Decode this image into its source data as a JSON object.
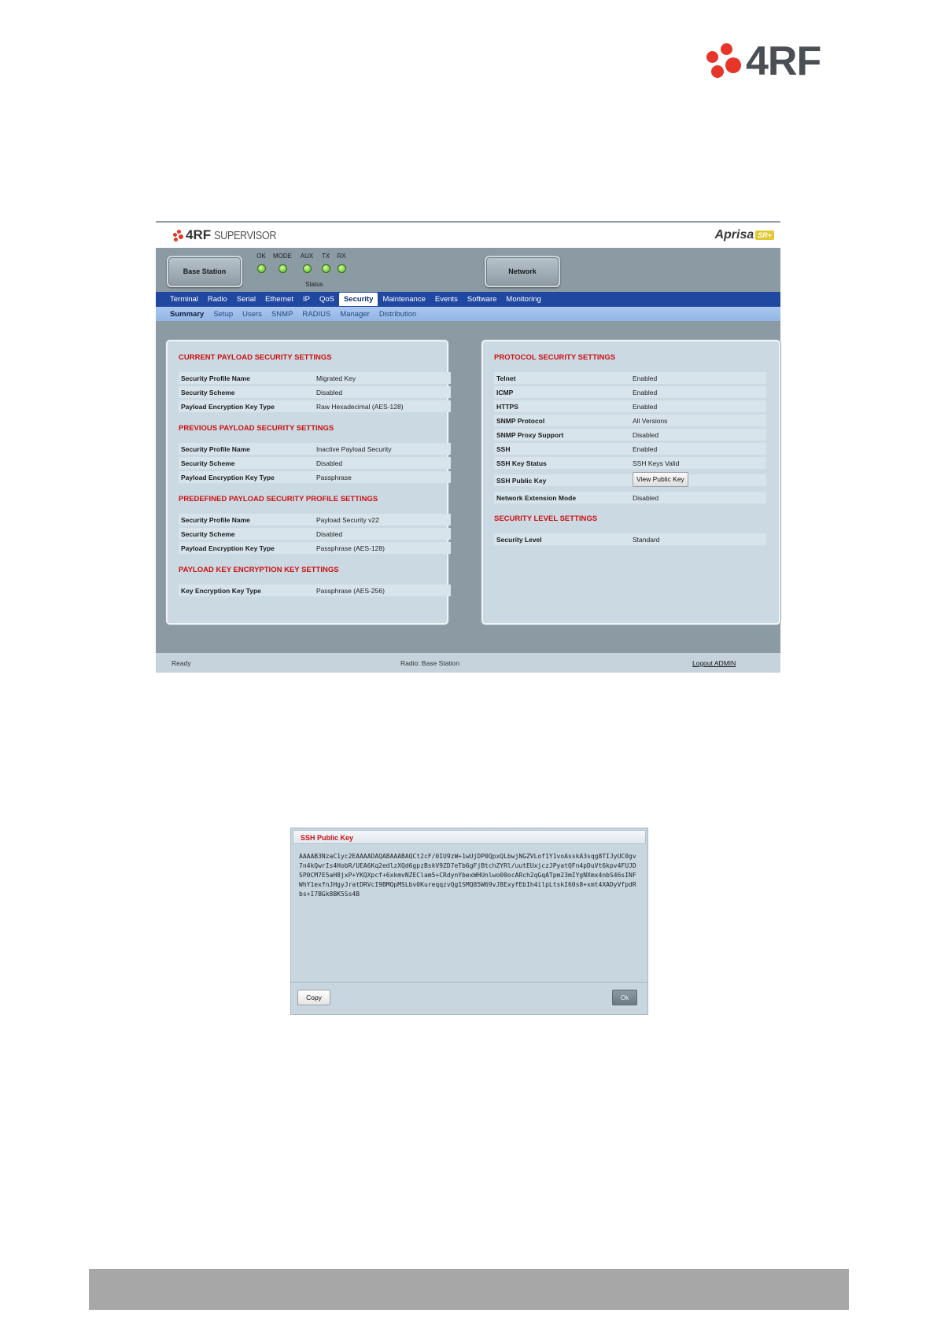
{
  "page": {
    "logo_text": "4RF"
  },
  "app": {
    "logo_brand": "4RF",
    "logo_product": "SUPERVISOR",
    "product_name": "Aprisa",
    "product_badge": "SR+",
    "header": {
      "base_station_label": "Base Station",
      "network_label": "Network",
      "status_label": "Status",
      "leds": [
        "OK",
        "MODE",
        "AUX",
        "TX",
        "RX"
      ]
    },
    "nav": {
      "main": [
        "Terminal",
        "Radio",
        "Serial",
        "Ethernet",
        "IP",
        "QoS",
        "Security",
        "Maintenance",
        "Events",
        "Software",
        "Monitoring"
      ],
      "main_active": "Security",
      "sub": [
        "Summary",
        "Setup",
        "Users",
        "SNMP",
        "RADIUS",
        "Manager",
        "Distribution"
      ],
      "sub_active": "Summary"
    },
    "left_panel": {
      "sections": [
        {
          "title": "CURRENT PAYLOAD SECURITY SETTINGS",
          "rows": [
            {
              "label": "Security Profile Name",
              "value": "Migrated Key"
            },
            {
              "label": "Security Scheme",
              "value": "Disabled"
            },
            {
              "label": "Payload Encryption Key Type",
              "value": "Raw Hexadecimal (AES-128)"
            }
          ]
        },
        {
          "title": "PREVIOUS PAYLOAD SECURITY SETTINGS",
          "rows": [
            {
              "label": "Security Profile Name",
              "value": "Inactive Payload Security"
            },
            {
              "label": "Security Scheme",
              "value": "Disabled"
            },
            {
              "label": "Payload Encryption Key Type",
              "value": "Passphrase"
            }
          ]
        },
        {
          "title": "PREDEFINED PAYLOAD SECURITY PROFILE SETTINGS",
          "rows": [
            {
              "label": "Security Profile Name",
              "value": "Payload Security v22"
            },
            {
              "label": "Security Scheme",
              "value": "Disabled"
            },
            {
              "label": "Payload Encryption Key Type",
              "value": "Passphrase (AES-128)"
            }
          ]
        },
        {
          "title": "PAYLOAD KEY ENCRYPTION KEY SETTINGS",
          "rows": [
            {
              "label": "Key Encryption Key Type",
              "value": "Passphrase (AES-256)"
            }
          ]
        }
      ]
    },
    "right_panel": {
      "protocol_title": "PROTOCOL SECURITY SETTINGS",
      "protocol_rows": [
        {
          "label": "Telnet",
          "value": "Enabled"
        },
        {
          "label": "ICMP",
          "value": "Enabled"
        },
        {
          "label": "HTTPS",
          "value": "Enabled"
        },
        {
          "label": "SNMP Protocol",
          "value": "All Versions"
        },
        {
          "label": "SNMP Proxy Support",
          "value": "Disabled"
        },
        {
          "label": "SSH",
          "value": "Enabled"
        },
        {
          "label": "SSH Key Status",
          "value": "SSH Keys Valid"
        },
        {
          "label": "SSH Public Key",
          "button": "View Public Key"
        },
        {
          "label": "Network Extension Mode",
          "value": "Disabled"
        }
      ],
      "level_title": "SECURITY LEVEL SETTINGS",
      "level_rows": [
        {
          "label": "Security Level",
          "value": "Standard"
        }
      ]
    },
    "status_bar": {
      "left": "Ready",
      "center": "Radio: Base Station",
      "logout": "Logout ADMIN"
    }
  },
  "dialog": {
    "title": "SSH Public Key",
    "key_text": "AAAAB3NzaC1yc2EAAAADAQABAAABAQCt2cF/0IU9zW+1wUjDP0QpxQLbwjNGZVLof1Y1voAsskA3sqg8TIJyUC0gv7n4kQwrIs4HobR/UEA6Kq2edlzXQd6gpzBskV9ZD7eTb6gFjBtchZYRl/uutEUxjczJPyatQFn4pDuVt6kpv4FUJDSP0CM7E5aH8jxP+YKQXpcf+6xkmvNZEClam5+CRdynYbexWHUnlwo00ocARch2qGqATpm23mIYgNXmx4nbS46sINFWhY1exfnJHgyJratDRVcI9BMQpMSLbv0KureqqzvQg1SMQ85W69vJ8ExyfEbIh4ilpLtskI60s8+xmt4XADyVfpdRbs+I7BGk8BK5Ss4B",
    "copy_label": "Copy",
    "ok_label": "Ok"
  }
}
